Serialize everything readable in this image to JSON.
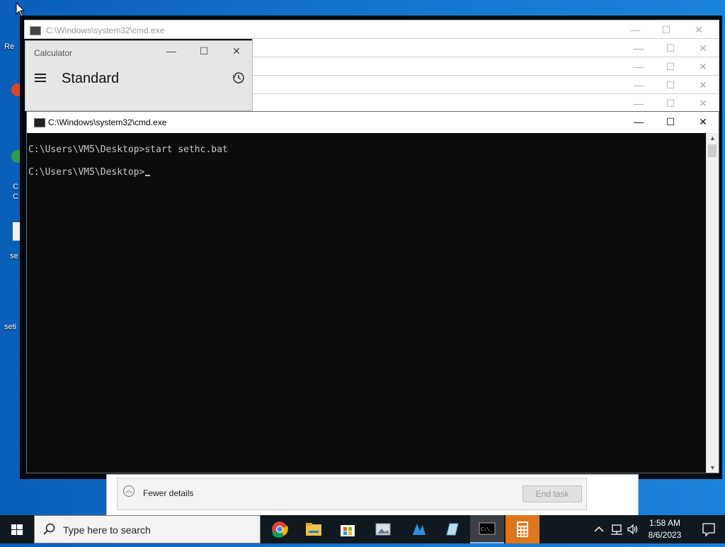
{
  "desktop": {
    "labels": [
      "Re",
      "C",
      "C",
      "se",
      "seti"
    ]
  },
  "task_manager": {
    "fewer_details": "Fewer details",
    "end_task": "End task"
  },
  "background_windows": [
    {
      "title": "C:\\Windows\\system32\\cmd.exe"
    }
  ],
  "calculator": {
    "title": "Calculator",
    "mode": "Standard"
  },
  "cmd": {
    "title": "C:\\Windows\\system32\\cmd.exe",
    "lines": [
      "C:\\Users\\VM5\\Desktop>start sethc.bat",
      "C:\\Users\\VM5\\Desktop>"
    ]
  },
  "taskbar": {
    "search_placeholder": "Type here to search",
    "time": "1:58 AM",
    "date": "8/6/2023",
    "apps": [
      "chrome-icon",
      "file-explorer-icon",
      "store-icon",
      "photos-icon",
      "network-icon",
      "notepad-icon",
      "cmd-icon",
      "calculator-icon"
    ]
  }
}
